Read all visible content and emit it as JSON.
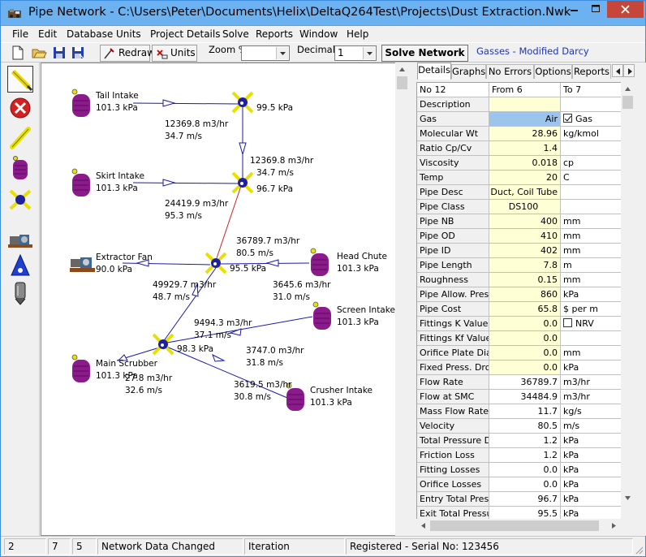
{
  "window": {
    "title": "Pipe Network - C:\\Users\\Peter\\Documents\\Helix\\DeltaQ264Test\\Projects\\Dust Extraction.Nwk"
  },
  "menu": [
    "File",
    "Edit",
    "Database",
    "Units",
    "Project Details",
    "Solve",
    "Reports",
    "Window",
    "Help"
  ],
  "toolbar": {
    "redraw_label": "Redraw",
    "units_label": "Units",
    "zoom_label": "Zoom %",
    "zoom_value": "",
    "decimals_label": "Decimals",
    "decimals_value": "1",
    "solve_label": "Solve Network",
    "gas_method": "Gasses - Modified Darcy"
  },
  "nodes": {
    "tail_intake": {
      "name": "Tail Intake",
      "pressure": "101.3 kPa"
    },
    "skirt_intake": {
      "name": "Skirt Intake",
      "pressure": "101.3 kPa"
    },
    "extractor_fan": {
      "name": "Extractor Fan",
      "pressure": "90.0 kPa"
    },
    "head_chute": {
      "name": "Head Chute",
      "pressure": "101.3 kPa"
    },
    "screen_intake": {
      "name": "Screen Intake",
      "pressure": "101.3 kPa"
    },
    "main_scrubber": {
      "name": "Main Scrubber",
      "pressure": "101.3 kPa"
    },
    "crusher_intake": {
      "name": "Crusher Intake",
      "pressure": "101.3 kPa"
    },
    "j1_pressure": "99.5 kPa",
    "j2_pressure": "96.7 kPa",
    "j3_pressure": "95.5 kPa",
    "j4_pressure": "98.3 kPa"
  },
  "pipes": {
    "p_tail": {
      "flow": "12369.8 m3/hr",
      "velocity": "34.7 m/s"
    },
    "p_j1j2": {
      "flow": "12369.8 m3/hr",
      "velocity": "34.7 m/s"
    },
    "p_skirt": {
      "flow": "24419.9 m3/hr",
      "velocity": "95.3 m/s"
    },
    "p_j2j3": {
      "flow": "36789.7 m3/hr",
      "velocity": "80.5 m/s"
    },
    "p_head": {
      "flow": "3645.6 m3/hr",
      "velocity": "31.0 m/s"
    },
    "p_j4j3": {
      "flow": "49929.7 m3/hr",
      "velocity": "48.7 m/s"
    },
    "p_screen": {
      "flow": "9494.3 m3/hr",
      "velocity": "37.1 m/s"
    },
    "p_crusher_a": {
      "flow": "3747.0 m3/hr",
      "velocity": "31.8 m/s"
    },
    "p_crusher_b": {
      "flow": "3619.5 m3/hr",
      "velocity": "30.8 m/s"
    },
    "p_scrubber": {
      "flow": "27.8 m3/hr",
      "velocity": "32.6 m/s"
    }
  },
  "tabs": [
    "Details",
    "Graphs",
    "No Errors",
    "Options",
    "Reports"
  ],
  "details": {
    "header": {
      "name": "No 12",
      "from": "From 6",
      "to": "To 7"
    },
    "rows": [
      {
        "label": "Description",
        "value": "",
        "unit": "",
        "kind": "input"
      },
      {
        "label": "Gas",
        "value": "Air",
        "unit": "Gas",
        "kind": "gas",
        "check": true
      },
      {
        "label": "Molecular Wt",
        "value": "28.96",
        "unit": "kg/kmol",
        "kind": "input"
      },
      {
        "label": "Ratio Cp/Cv",
        "value": "1.4",
        "unit": "",
        "kind": "input"
      },
      {
        "label": "Viscosity",
        "value": "0.018",
        "unit": "cp",
        "kind": "input"
      },
      {
        "label": "Temp",
        "value": "20",
        "unit": "C",
        "kind": "input"
      },
      {
        "label": "Pipe Desc",
        "value": "Duct, Coil Tube",
        "unit": "",
        "kind": "input"
      },
      {
        "label": "Pipe Class",
        "value": "DS100",
        "unit": "",
        "kind": "input"
      },
      {
        "label": "Pipe NB",
        "value": "400",
        "unit": "mm",
        "kind": "input"
      },
      {
        "label": "Pipe OD",
        "value": "410",
        "unit": "mm",
        "kind": "input"
      },
      {
        "label": "Pipe ID",
        "value": "402",
        "unit": "mm",
        "kind": "input"
      },
      {
        "label": "Pipe Length",
        "value": "7.8",
        "unit": "m",
        "kind": "input"
      },
      {
        "label": "Roughness",
        "value": "0.15",
        "unit": "mm",
        "kind": "input"
      },
      {
        "label": "Pipe Allow. Press.",
        "value": "860",
        "unit": "kPa",
        "kind": "input"
      },
      {
        "label": "Pipe Cost",
        "value": "65.8",
        "unit": "$ per m",
        "kind": "input"
      },
      {
        "label": "Fittings K Value",
        "value": "0.0",
        "unit": "NRV",
        "kind": "input",
        "check": false
      },
      {
        "label": "Fittings Kf Value",
        "value": "0.0",
        "unit": "",
        "kind": "input"
      },
      {
        "label": "Orifice Plate Dia",
        "value": "0.0",
        "unit": "mm",
        "kind": "input"
      },
      {
        "label": "Fixed Press. Drop",
        "value": "0.0",
        "unit": "kPa",
        "kind": "input"
      },
      {
        "label": "Flow Rate",
        "value": "36789.7",
        "unit": "m3/hr",
        "kind": "computed"
      },
      {
        "label": "Flow at SMC",
        "value": "34484.9",
        "unit": "m3/hr",
        "kind": "computed"
      },
      {
        "label": "Mass Flow Rate",
        "value": "11.7",
        "unit": "kg/s",
        "kind": "computed"
      },
      {
        "label": "Velocity",
        "value": "80.5",
        "unit": "m/s",
        "kind": "computed"
      },
      {
        "label": "Total Pressure Dr",
        "value": "1.2",
        "unit": "kPa",
        "kind": "computed"
      },
      {
        "label": "Friction Loss",
        "value": "1.2",
        "unit": "kPa",
        "kind": "computed"
      },
      {
        "label": "Fitting Losses",
        "value": "0.0",
        "unit": "kPa",
        "kind": "computed"
      },
      {
        "label": "Orifice Losses",
        "value": "0.0",
        "unit": "kPa",
        "kind": "computed"
      },
      {
        "label": "Entry Total Pressu",
        "value": "96.7",
        "unit": "kPa",
        "kind": "computed"
      },
      {
        "label": "Exit Total Pressur",
        "value": "95.5",
        "unit": "kPa",
        "kind": "computed"
      }
    ]
  },
  "status": {
    "a": "2",
    "b": "7",
    "c": "5",
    "message": "Network Data Changed",
    "mode": "Iteration",
    "registration": "Registered - Serial No: 123456"
  },
  "colors": {
    "tank": "#8b1a8b",
    "pipe_line": "#1a1aa8",
    "selected_pipe": "#cc2020",
    "junction": "#1f1fa0",
    "junction_arms": "#e8e000",
    "input_cell": "#ffffd6",
    "gas_cell": "#9cc4ec"
  }
}
